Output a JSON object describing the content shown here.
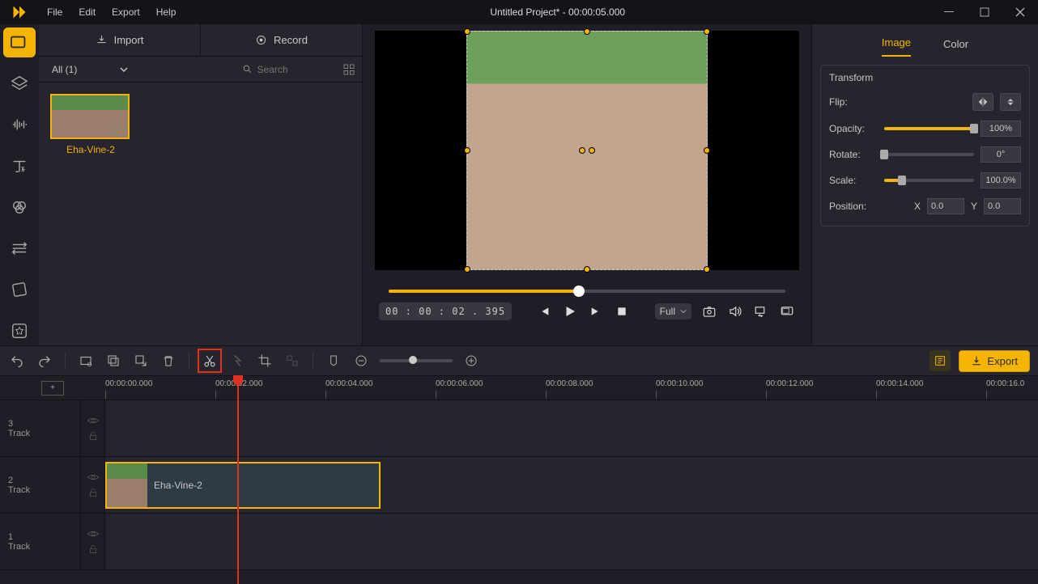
{
  "title": "Untitled Project* - 00:00:05.000",
  "menu": {
    "file": "File",
    "edit": "Edit",
    "export": "Export",
    "help": "Help"
  },
  "media": {
    "import": "Import",
    "record": "Record",
    "filter": "All (1)",
    "search_placeholder": "Search",
    "thumb": {
      "name": "Eha-Vine-2"
    }
  },
  "preview": {
    "timecode": "00 : 00 : 02 . 395",
    "fit": "Full"
  },
  "props": {
    "tabs": {
      "image": "Image",
      "color": "Color"
    },
    "section": "Transform",
    "flip": "Flip:",
    "opacity": "Opacity:",
    "opacity_val": "100%",
    "rotate": "Rotate:",
    "rotate_val": "0°",
    "scale": "Scale:",
    "scale_val": "100.0%",
    "position": "Position:",
    "pos_x_label": "X",
    "pos_x": "0.0",
    "pos_y_label": "Y",
    "pos_y": "0.0"
  },
  "toolbar": {
    "export": "Export"
  },
  "ruler": {
    "t0": "00:00:00.000",
    "t1": "00:00:02.000",
    "t2": "00:00:04.000",
    "t3": "00:00:06.000",
    "t4": "00:00:08.000",
    "t5": "00:00:10.000",
    "t6": "00:00:12.000",
    "t7": "00:00:14.000",
    "t8": "00:00:16.0"
  },
  "tracks": {
    "t3_num": "3",
    "t3_label": "Track",
    "t2_num": "2",
    "t2_label": "Track",
    "t1_num": "1",
    "t1_label": "Track",
    "clip_name": "Eha-Vine-2"
  }
}
